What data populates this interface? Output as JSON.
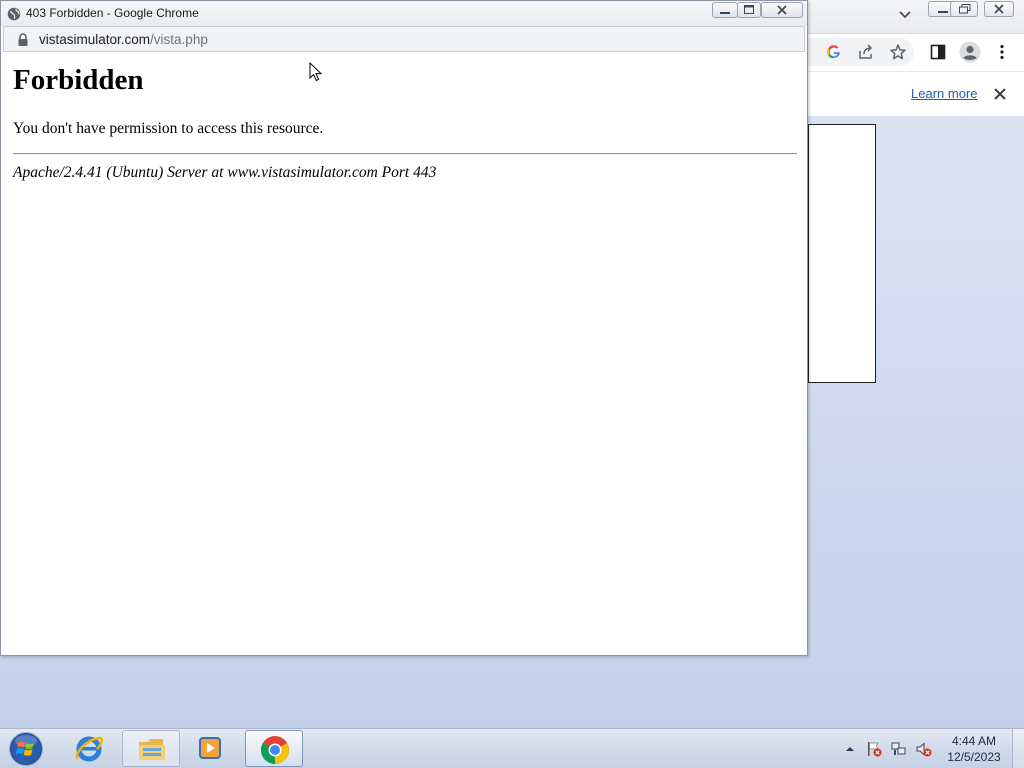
{
  "popup": {
    "title": "403 Forbidden - Google Chrome",
    "url_host": "vistasimulator.com",
    "url_path": "/vista.php"
  },
  "page": {
    "heading": "Forbidden",
    "message": "You don't have permission to access this resource.",
    "server_signature": "Apache/2.4.41 (Ubuntu) Server at www.vistasimulator.com Port 443"
  },
  "background_window": {
    "infobar_link": "Learn more"
  },
  "taskbar": {
    "clock_time": "4:44 AM",
    "clock_date": "12/5/2023"
  },
  "colors": {
    "link": "#1a5fb4",
    "desktop": "#d3dcef"
  }
}
